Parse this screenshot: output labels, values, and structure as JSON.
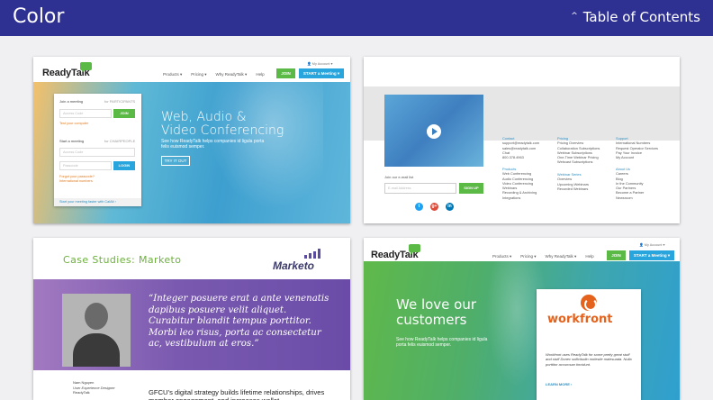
{
  "header": {
    "title": "Color",
    "toc_label": "Table of Contents",
    "bg": "#2e3192"
  },
  "card1": {
    "logo": "ReadyTalk",
    "nav": [
      "Products ▾",
      "Pricing ▾",
      "Why ReadyTalk ▾",
      "Help"
    ],
    "join": "JOIN",
    "start": "START a Meeting ▾",
    "account": "👤 My Account ▾",
    "headline1": "Web, Audio &",
    "headline2": "Video Conferencing",
    "sub": "See how ReadyTalk helps companies id ligula porta felis euismod semper.",
    "tryit": "TRY IT OUT",
    "login": {
      "join_label": "Join a meeting",
      "participants": "for PARTICIPANTS",
      "access_code": "Access Code",
      "join_btn": "JOIN",
      "test": "Test your computer",
      "start_label": "Start a meeting",
      "chairpeople": "for CHAIRPEOPLE",
      "access_code2": "Access Code",
      "password": "Passcode",
      "login_btn": "LOGIN",
      "forgot": "Forgot your passcode?",
      "intl": "International numbers",
      "footer": "Start your meeting faster with CalAlt ›"
    }
  },
  "card2": {
    "email_label": "Join our e-mail list",
    "email_placeholder": "E-mail Address",
    "signup": "SIGN UP",
    "social": [
      "t",
      "g+",
      "in"
    ],
    "contact": {
      "title": "Contact",
      "items": [
        "support@readytalk.com",
        "sales@readytalk.com",
        "Chat",
        "800.378.4963"
      ]
    },
    "products": {
      "title": "Products",
      "items": [
        "Web Conferencing",
        "Audio Conferencing",
        "Video Conferencing",
        "Webinars",
        "Recording & Archiving",
        "Integrations"
      ]
    },
    "pricing": {
      "title": "Pricing",
      "items": [
        "Pricing Overview",
        "Collaboration Subscriptions",
        "Webinar Subscriptions",
        "One-Time Webinar Pricing",
        "Webcast Subscriptions"
      ]
    },
    "webinar": {
      "title": "Webinar Series",
      "items": [
        "Overview",
        "Upcoming Webinars",
        "Recorded Webinars"
      ]
    },
    "support": {
      "title": "Support",
      "items": [
        "International Numbers",
        "Request Operator Services",
        "Pay Your Invoice",
        "My Account"
      ]
    },
    "about": {
      "title": "About Us",
      "items": [
        "Careers",
        "Blog",
        "In the Community",
        "Our Partners",
        "Become a Partner",
        "Newsroom"
      ]
    }
  },
  "card3": {
    "title": "Case Studies: Marketo",
    "brand": "Marketo",
    "quote": "“Integer posuere erat a ante venenatis dapibus posuere velit aliquet. Curabitur blandit tempus porttitor. Morbi leo risus, porta ac consectetur ac, vestibulum at eros.”",
    "person_name": "Nam Nguyen",
    "person_role": "User Experience Designer",
    "person_company": "ReadyTalk",
    "body": "GFCU’s digital strategy builds lifetime relationships, drives member engagement, and increases wallet"
  },
  "card4": {
    "logo": "ReadyTalk",
    "nav": [
      "Products ▾",
      "Pricing ▾",
      "Why ReadyTalk ▾",
      "Help"
    ],
    "join": "JOIN",
    "start": "START a Meeting ▾",
    "account": "👤 My Account ▾",
    "headline1": "We love our",
    "headline2": "customers",
    "sub": "See how ReadyTalk helps companies id ligula porta felis euismod semper.",
    "brand": "workfront",
    "blurb": "Workfront uses ReadyTalk for some pretty great stuff and stuff Donec sollicitudin molestie malesuada. Nulla porttitor accumsan tincidunt.",
    "more": "LEARN MORE ›"
  }
}
